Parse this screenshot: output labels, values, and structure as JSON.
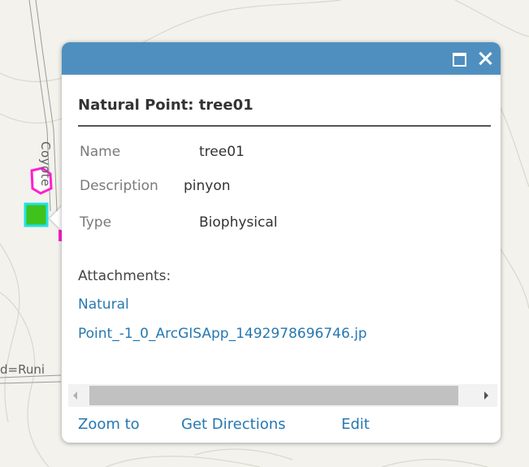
{
  "map": {
    "road_label_vertical": "Coyote",
    "road_label_horizontal": "d=Runi"
  },
  "popup": {
    "title": "Natural Point: tree01",
    "maximize_icon": "maximize-icon",
    "close_icon": "close-icon",
    "attributes": [
      {
        "name": "Name",
        "value": "tree01"
      },
      {
        "name": "Description",
        "value": "pinyon"
      },
      {
        "name": "Type",
        "value": "Biophysical"
      }
    ],
    "attachments_heading": "Attachments:",
    "attachment_link": {
      "line1": "Natural",
      "line2": "Point_-1_0_ArcGISApp_1492978696746.jp"
    },
    "actions": {
      "zoom": "Zoom to",
      "directions": "Get Directions",
      "edit": "Edit"
    }
  },
  "colors": {
    "titlebar": "#4f8fbf",
    "link": "#2778b1",
    "map_background": "#f3f2ec",
    "feature_magenta": "#ff1fd0",
    "feature_green": "#3fc21c",
    "feature_cyan": "#22e0e8"
  }
}
